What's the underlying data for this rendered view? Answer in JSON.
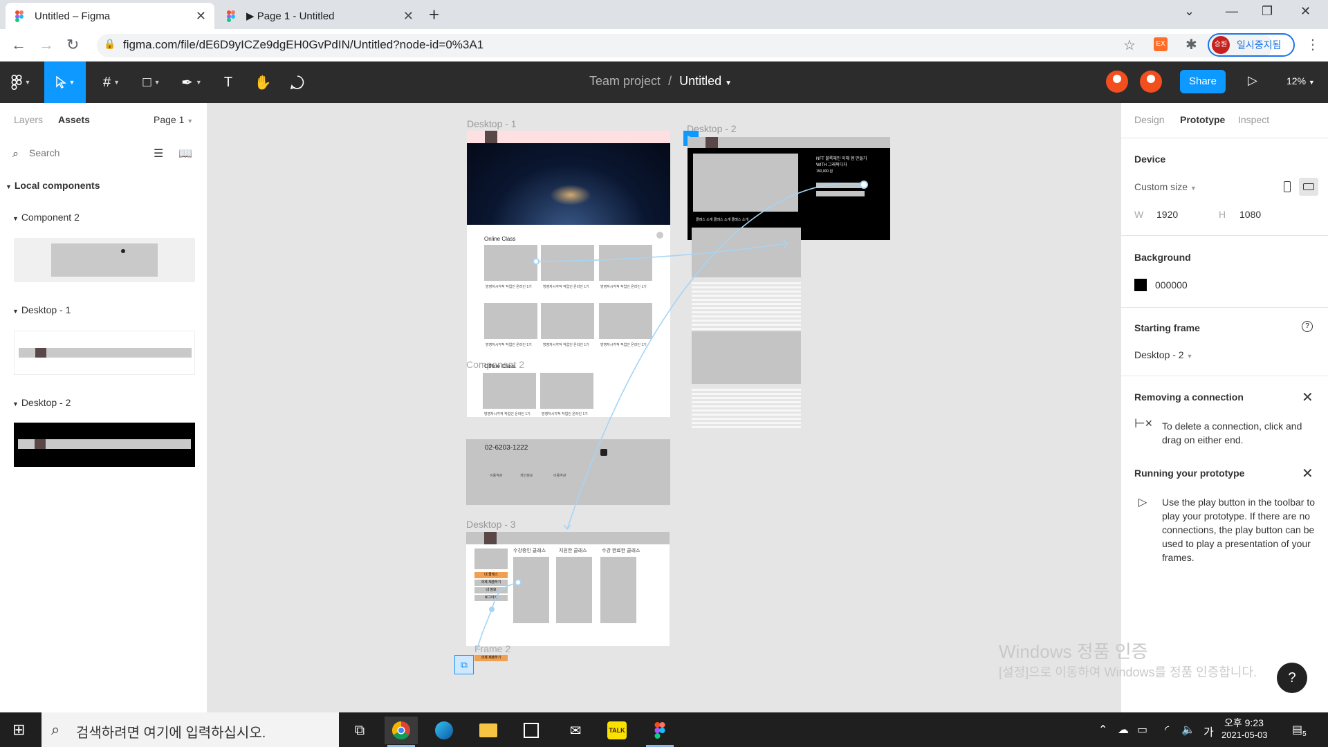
{
  "browser": {
    "tabs": [
      {
        "title": "Untitled – Figma",
        "close": "✕"
      },
      {
        "title": "▶ Page 1 - Untitled",
        "close": "✕"
      }
    ],
    "new_tab": "+",
    "url": "figma.com/file/dE6D9yICZe9dgEH0GvPdIN/Untitled?node-id=0%3A1",
    "profile_label": "일시중지됨",
    "profile_avatar": "승원",
    "ext_label": "EX"
  },
  "figma": {
    "team": "Team project",
    "separator": "/",
    "file_name": "Untitled",
    "share_label": "Share",
    "zoom": "12%",
    "left_tabs": {
      "layers": "Layers",
      "assets": "Assets",
      "page": "Page 1"
    },
    "search_placeholder": "Search",
    "local_components": "Local components",
    "components": [
      "Component 2",
      "Desktop - 1",
      "Desktop - 2"
    ],
    "right_tabs": {
      "design": "Design",
      "prototype": "Prototype",
      "inspect": "Inspect"
    },
    "device": {
      "title": "Device",
      "size": "Custom size",
      "w_label": "W",
      "w": "1920",
      "h_label": "H",
      "h": "1080"
    },
    "background": {
      "title": "Background",
      "hex": "000000"
    },
    "starting_frame": {
      "title": "Starting frame",
      "value": "Desktop - 2"
    },
    "removing": {
      "title": "Removing a connection",
      "text": "To delete a connection, click and drag on either end."
    },
    "running": {
      "title": "Running your prototype",
      "text": "Use the play button in the toolbar to play your prototype. If there are no connections, the play button can be used to play a presentation of your frames."
    }
  },
  "canvas": {
    "frames": {
      "d1": "Desktop - 1",
      "d2": "Desktop - 2",
      "d3": "Desktop - 3",
      "comp2": "Component 2",
      "frame2": "Frame 2"
    },
    "online_class": "Online Class",
    "offline_class": "Offline Class",
    "phone": "02-6203-1222",
    "footer_links": [
      "이용약관",
      "개인정보",
      "이용약관"
    ],
    "d2_headline": "NFT 블록체인 이해 앱 만들기 WITH 그래픽디자",
    "d2_price": "150,000 원",
    "d2_tabs": "클래스 소개   클래스 소개   클래스 소개",
    "d3_tabs": [
      "수강중인 클래스",
      "지원한 클래스",
      "수강 완료한 클래스"
    ],
    "d3_menu": [
      "내 클래스",
      "과제 제출하기",
      "내 정보",
      "로그아웃"
    ],
    "frame2_button": "과제 제출하기",
    "card_text": "방영자시각적 작업인 온라인 1기"
  },
  "windows": {
    "watermark_title": "Windows 정품 인증",
    "watermark_sub": "[설정]으로 이동하여 Windows를 정품 인증합니다.",
    "search_text": "검색하려면 여기에 입력하십시오.",
    "time": "오후 9:23",
    "date": "2021-05-03",
    "ime": "가",
    "notif": "5",
    "help": "?"
  }
}
